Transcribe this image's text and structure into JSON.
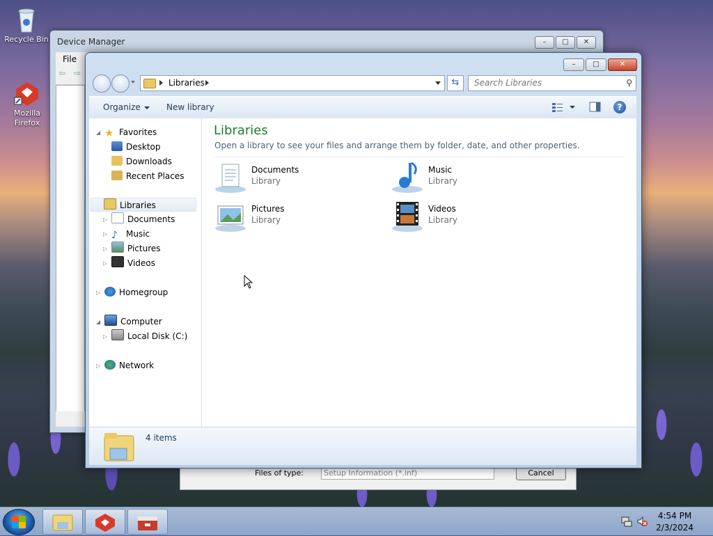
{
  "desktop": {
    "icons": [
      {
        "label": "Recycle Bin"
      },
      {
        "label": "Mozilla Firefox"
      }
    ]
  },
  "device_manager": {
    "title": "Device Manager",
    "menu": [
      "File"
    ]
  },
  "file_dialog": {
    "files_of_type_label": "Files of type:",
    "files_of_type_value": "Setup Information (*.inf)",
    "cancel_label": "Cancel"
  },
  "explorer": {
    "address": {
      "crumb": "Libraries"
    },
    "search": {
      "placeholder": "Search Libraries"
    },
    "toolbar": {
      "organize": "Organize",
      "new_library": "New library"
    },
    "nav": {
      "favorites": "Favorites",
      "desktop": "Desktop",
      "downloads": "Downloads",
      "recent_places": "Recent Places",
      "libraries": "Libraries",
      "documents": "Documents",
      "music": "Music",
      "pictures": "Pictures",
      "videos": "Videos",
      "homegroup": "Homegroup",
      "computer": "Computer",
      "local_disk": "Local Disk (C:)",
      "network": "Network"
    },
    "content": {
      "title": "Libraries",
      "subtitle": "Open a library to see your files and arrange them by folder, date, and other properties.",
      "libraries": [
        {
          "name": "Documents",
          "type": "Library"
        },
        {
          "name": "Music",
          "type": "Library"
        },
        {
          "name": "Pictures",
          "type": "Library"
        },
        {
          "name": "Videos",
          "type": "Library"
        }
      ]
    },
    "details": {
      "count": "4 items"
    }
  },
  "taskbar": {
    "time": "4:54 PM",
    "date": "2/3/2024"
  }
}
